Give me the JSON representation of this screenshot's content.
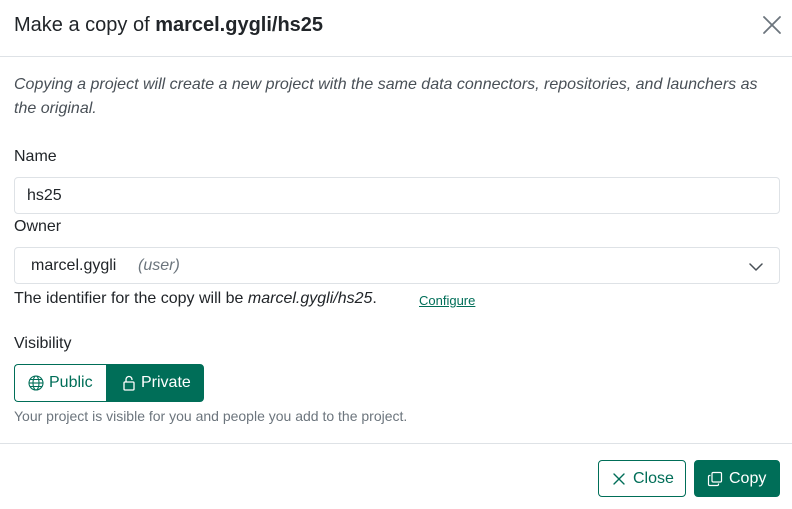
{
  "modal": {
    "title_prefix": "Make a copy of",
    "title_project": "marcel.gygli/hs25",
    "description": "Copying a project will create a new project with the same data connectors, repositories, and launchers as the original."
  },
  "form": {
    "name_label": "Name",
    "name_value": "hs25",
    "owner_label": "Owner",
    "owner_value": "marcel.gygli",
    "owner_kind": "(user)",
    "identifier_prefix": "The identifier for the copy will be",
    "identifier_value": "marcel.gygli/hs25",
    "identifier_suffix": ".",
    "configure_link": "Configure",
    "visibility_label": "Visibility",
    "visibility_options": [
      {
        "label": "Public",
        "icon": "globe-icon",
        "selected": false
      },
      {
        "label": "Private",
        "icon": "lock-icon",
        "selected": true
      }
    ],
    "visibility_help": "Your project is visible for you and people you add to the project."
  },
  "footer": {
    "close_label": "Close",
    "copy_label": "Copy"
  },
  "colors": {
    "accent": "#006e58",
    "border": "#dee2e6",
    "muted": "#6c757d"
  }
}
